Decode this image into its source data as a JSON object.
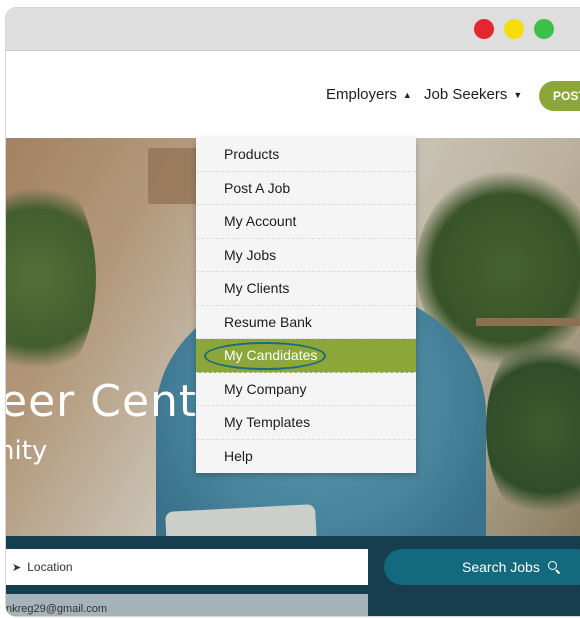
{
  "window": {
    "controls": [
      "close",
      "minimize",
      "maximize"
    ]
  },
  "navbar": {
    "employers_label": "Employers",
    "employers_caret": "▲",
    "jobseekers_label": "Job Seekers",
    "jobseekers_caret": "▼",
    "post_label": "POST"
  },
  "dropdown": {
    "items": [
      {
        "label": "Products"
      },
      {
        "label": "Post A Job"
      },
      {
        "label": "My Account"
      },
      {
        "label": "My Jobs"
      },
      {
        "label": "My Clients"
      },
      {
        "label": "Resume Bank"
      },
      {
        "label": "My Candidates",
        "active": true
      },
      {
        "label": "My Company"
      },
      {
        "label": "My Templates"
      },
      {
        "label": "Help"
      }
    ]
  },
  "hero": {
    "title": "eer Center",
    "subtitle": "nity"
  },
  "search": {
    "location_label": "Location",
    "location_icon": "location-arrow-icon",
    "email": "nkreg29@gmail.com",
    "button_label": "Search Jobs",
    "button_icon": "search-icon"
  },
  "colors": {
    "accent_green": "#8da63a",
    "navy": "#173e4e",
    "teal_button": "#136a7e",
    "highlight_ring": "#166b7c"
  }
}
